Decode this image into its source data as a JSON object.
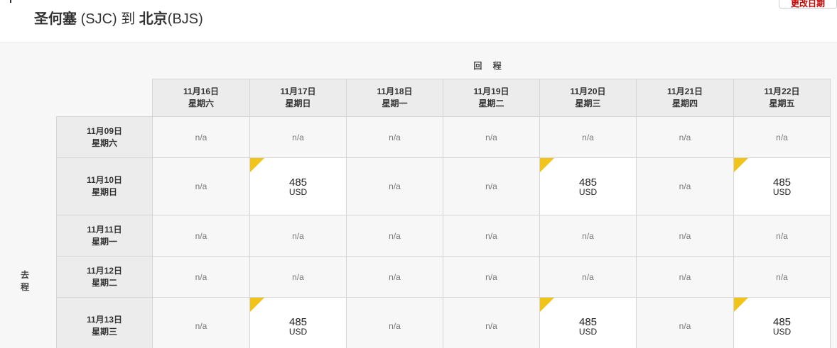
{
  "header": {
    "origin_city": "圣何塞",
    "origin_code": "(SJC)",
    "connector": "到",
    "dest_city": "北京",
    "dest_code": "(BJS)",
    "change_date_button": "更改日期"
  },
  "grid": {
    "return_label": "回 程",
    "outbound_label_1": "去",
    "outbound_label_2": "程",
    "columns": [
      {
        "date": "11月16日",
        "weekday": "星期六"
      },
      {
        "date": "11月17日",
        "weekday": "星期日"
      },
      {
        "date": "11月18日",
        "weekday": "星期一"
      },
      {
        "date": "11月19日",
        "weekday": "星期二"
      },
      {
        "date": "11月20日",
        "weekday": "星期三"
      },
      {
        "date": "11月21日",
        "weekday": "星期四"
      },
      {
        "date": "11月22日",
        "weekday": "星期五"
      }
    ],
    "rows": [
      {
        "date": "11月09日",
        "weekday": "星期六",
        "cells": [
          "n/a",
          "n/a",
          "n/a",
          "n/a",
          "n/a",
          "n/a",
          "n/a"
        ]
      },
      {
        "date": "11月10日",
        "weekday": "星期日",
        "cells": [
          "n/a",
          "485",
          "n/a",
          "n/a",
          "485",
          "n/a",
          "485"
        ]
      },
      {
        "date": "11月11日",
        "weekday": "星期一",
        "cells": [
          "n/a",
          "n/a",
          "n/a",
          "n/a",
          "n/a",
          "n/a",
          "n/a"
        ]
      },
      {
        "date": "11月12日",
        "weekday": "星期二",
        "cells": [
          "n/a",
          "n/a",
          "n/a",
          "n/a",
          "n/a",
          "n/a",
          "n/a"
        ]
      },
      {
        "date": "11月13日",
        "weekday": "星期三",
        "cells": [
          "n/a",
          "485",
          "n/a",
          "n/a",
          "485",
          "n/a",
          "485"
        ]
      }
    ],
    "currency": "USD",
    "flag_color": "#f0c419"
  }
}
